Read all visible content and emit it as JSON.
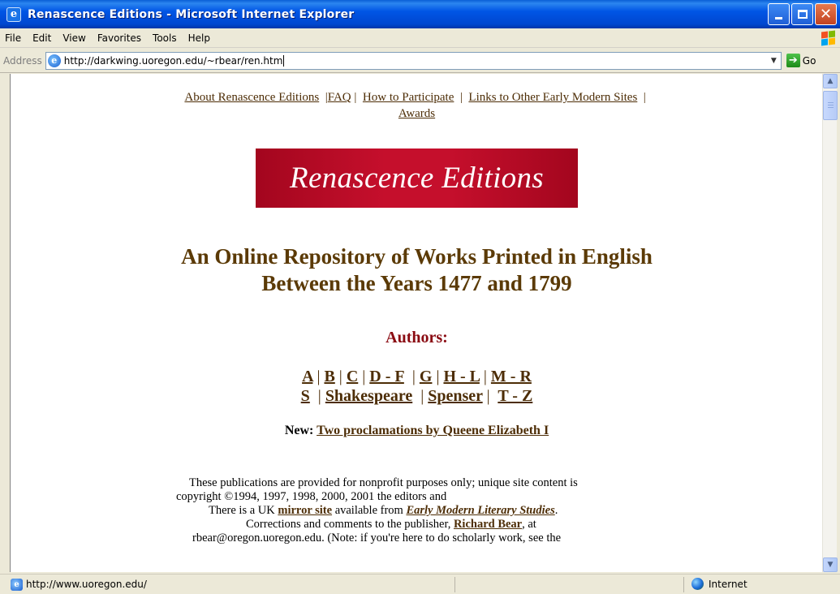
{
  "window": {
    "title": "Renascence Editions - Microsoft Internet Explorer",
    "icon": "ie-icon",
    "controls": [
      "minimize-icon",
      "maximize-icon",
      "close-icon"
    ]
  },
  "menu": [
    "File",
    "Edit",
    "View",
    "Favorites",
    "Tools",
    "Help"
  ],
  "address": {
    "label": "Address",
    "url": "http://darkwing.uoregon.edu/~rbear/ren.htm",
    "go_label": "Go"
  },
  "page": {
    "top_links": {
      "about": "About Renascence Editions",
      "faq": "FAQ",
      "participate": "How to Participate",
      "links": "Links to Other Early Modern Sites",
      "awards": "Awards"
    },
    "banner": "Renascence Editions",
    "headline": "An Online Repository of Works Printed in English Between the Years 1477 and 1799",
    "authors_title": "Authors:",
    "author_links": [
      "A",
      "B",
      "C",
      "D - F",
      "G",
      "H - L",
      "M - R",
      "S",
      "Shakespeare",
      "Spenser",
      "T - Z"
    ],
    "new_label": "New:",
    "new_link": "Two proclamations by Queene Elizabeth I",
    "info": {
      "line1": "These publications are provided for nonprofit purposes only; unique site content is",
      "line2": "copyright ©1994, 1997, 1998, 2000, 2001 the editors and",
      "mirror_pre": "There is a UK",
      "mirror_link": "mirror site",
      "mirror_mid": "available from",
      "mirror_site": "Early Modern Literary Studies",
      "corrections_pre": "Corrections and comments to the publisher,",
      "publisher": "Richard Bear",
      "corrections_post": ", at",
      "email_line": "rbear@oregon.uoregon.edu. (Note: if you're here to do scholarly work, see the"
    }
  },
  "status": {
    "text": "http://www.uoregon.edu/",
    "zone": "Internet"
  }
}
